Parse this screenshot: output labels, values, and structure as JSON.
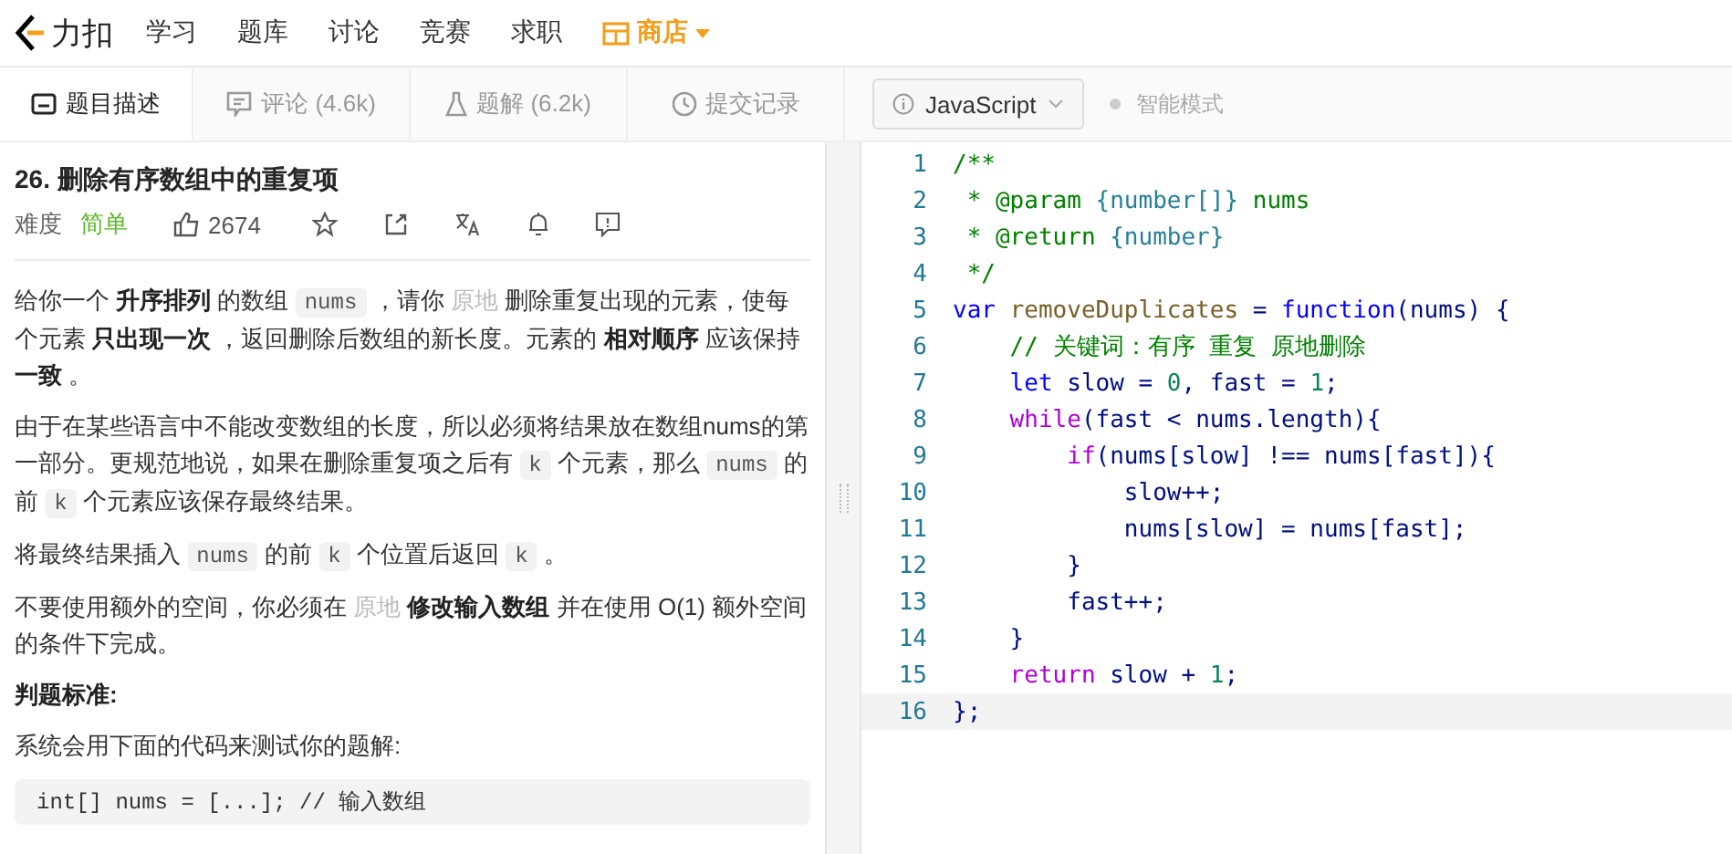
{
  "nav": {
    "logo": "力扣",
    "items": [
      {
        "label": "学习",
        "kind": "link"
      },
      {
        "label": "题库",
        "kind": "link"
      },
      {
        "label": "讨论",
        "kind": "link"
      },
      {
        "label": "竞赛",
        "kind": "link"
      },
      {
        "label": "求职",
        "kind": "link"
      },
      {
        "label": "商店",
        "kind": "store"
      }
    ]
  },
  "tabs": [
    {
      "label": "题目描述",
      "selected": true
    },
    {
      "label": "评论 (4.6k)",
      "selected": false
    },
    {
      "label": "题解 (6.2k)",
      "selected": false
    },
    {
      "label": "提交记录",
      "selected": false
    }
  ],
  "editor_toolbar": {
    "language": "JavaScript",
    "smart_mode": {
      "label": "智能模式",
      "on": false
    }
  },
  "problem": {
    "title": "26. 删除有序数组中的重复项",
    "difficulty_label": "难度",
    "difficulty": "简单",
    "likes": "2674",
    "paragraphs": [
      [
        {
          "kind": "text",
          "text": "给你一个 "
        },
        {
          "kind": "bold",
          "text": "升序排列"
        },
        {
          "kind": "text",
          "text": " 的数组 "
        },
        {
          "kind": "code",
          "text": "nums"
        },
        {
          "kind": "text",
          "text": " ，请你 "
        },
        {
          "kind": "muted",
          "text": "原地"
        },
        {
          "kind": "text",
          "text": " 删除重复出现的元素，使每个元素 "
        },
        {
          "kind": "bold",
          "text": "只出现一次"
        },
        {
          "kind": "text",
          "text": " ，返回删除后数组的新长度。元素的 "
        },
        {
          "kind": "bold",
          "text": "相对顺序"
        },
        {
          "kind": "text",
          "text": " 应该保持 "
        },
        {
          "kind": "bold",
          "text": "一致"
        },
        {
          "kind": "text",
          "text": " 。"
        }
      ],
      [
        {
          "kind": "text",
          "text": "由于在某些语言中不能改变数组的长度，所以必须将结果放在数组nums的第一部分。更规范地说，如果在删除重复项之后有 "
        },
        {
          "kind": "code",
          "text": "k"
        },
        {
          "kind": "text",
          "text": " 个元素，那么 "
        },
        {
          "kind": "code",
          "text": "nums"
        },
        {
          "kind": "text",
          "text": " 的前 "
        },
        {
          "kind": "code",
          "text": "k"
        },
        {
          "kind": "text",
          "text": " 个元素应该保存最终结果。"
        }
      ],
      [
        {
          "kind": "text",
          "text": "将最终结果插入 "
        },
        {
          "kind": "code",
          "text": "nums"
        },
        {
          "kind": "text",
          "text": " 的前 "
        },
        {
          "kind": "code",
          "text": "k"
        },
        {
          "kind": "text",
          "text": " 个位置后返回 "
        },
        {
          "kind": "code",
          "text": "k"
        },
        {
          "kind": "text",
          "text": " 。"
        }
      ],
      [
        {
          "kind": "text",
          "text": "不要使用额外的空间，你必须在 "
        },
        {
          "kind": "muted",
          "text": "原地"
        },
        {
          "kind": "bold",
          "text": " 修改输入数组"
        },
        {
          "kind": "text",
          "text": " 并在使用 O(1) 额外空间的条件下完成。"
        }
      ],
      [
        {
          "kind": "bold",
          "text": "判题标准:"
        }
      ],
      [
        {
          "kind": "text",
          "text": "系统会用下面的代码来测试你的题解:"
        }
      ]
    ],
    "sample_code": "int[] nums = [...]; // 输入数组"
  },
  "code": [
    {
      "number": "1",
      "tokens": [
        {
          "kind": "comment",
          "text": "/**"
        }
      ]
    },
    {
      "number": "2",
      "tokens": [
        {
          "kind": "comment",
          "text": " * @param "
        },
        {
          "kind": "doctype",
          "text": "{number[]}"
        },
        {
          "kind": "comment",
          "text": " nums"
        }
      ]
    },
    {
      "number": "3",
      "tokens": [
        {
          "kind": "comment",
          "text": " * @return "
        },
        {
          "kind": "doctype",
          "text": "{number}"
        }
      ]
    },
    {
      "number": "4",
      "tokens": [
        {
          "kind": "comment",
          "text": " */"
        }
      ]
    },
    {
      "number": "5",
      "tokens": [
        {
          "kind": "keyword",
          "text": "var "
        },
        {
          "kind": "fname",
          "text": "removeDuplicates"
        },
        {
          "kind": "plain",
          "text": " = "
        },
        {
          "kind": "keyword",
          "text": "function"
        },
        {
          "kind": "plain",
          "text": "(nums) {"
        }
      ]
    },
    {
      "number": "6",
      "tokens": [
        {
          "kind": "comment",
          "text": "    // 关键词：有序 重复 原地删除"
        }
      ]
    },
    {
      "number": "7",
      "tokens": [
        {
          "kind": "keyword",
          "text": "    let"
        },
        {
          "kind": "plain",
          "text": " slow = "
        },
        {
          "kind": "number",
          "text": "0"
        },
        {
          "kind": "plain",
          "text": ", fast = "
        },
        {
          "kind": "number",
          "text": "1"
        },
        {
          "kind": "plain",
          "text": ";"
        }
      ]
    },
    {
      "number": "8",
      "tokens": [
        {
          "kind": "control",
          "text": "    while"
        },
        {
          "kind": "plain",
          "text": "(fast < nums.length){"
        }
      ]
    },
    {
      "number": "9",
      "tokens": [
        {
          "kind": "control",
          "text": "        if"
        },
        {
          "kind": "plain",
          "text": "(nums[slow] !== nums[fast]){"
        }
      ]
    },
    {
      "number": "10",
      "tokens": [
        {
          "kind": "plain",
          "text": "            slow++;"
        }
      ]
    },
    {
      "number": "11",
      "tokens": [
        {
          "kind": "plain",
          "text": "            nums[slow] = nums[fast];"
        }
      ]
    },
    {
      "number": "12",
      "tokens": [
        {
          "kind": "plain",
          "text": "        }"
        }
      ]
    },
    {
      "number": "13",
      "tokens": [
        {
          "kind": "plain",
          "text": "        fast++;"
        }
      ]
    },
    {
      "number": "14",
      "tokens": [
        {
          "kind": "plain",
          "text": "    }"
        }
      ]
    },
    {
      "number": "15",
      "tokens": [
        {
          "kind": "control",
          "text": "    return"
        },
        {
          "kind": "plain",
          "text": " slow + "
        },
        {
          "kind": "number",
          "text": "1"
        },
        {
          "kind": "plain",
          "text": ";"
        }
      ]
    },
    {
      "number": "16",
      "tokens": [
        {
          "kind": "plain",
          "text": "};"
        }
      ]
    }
  ]
}
